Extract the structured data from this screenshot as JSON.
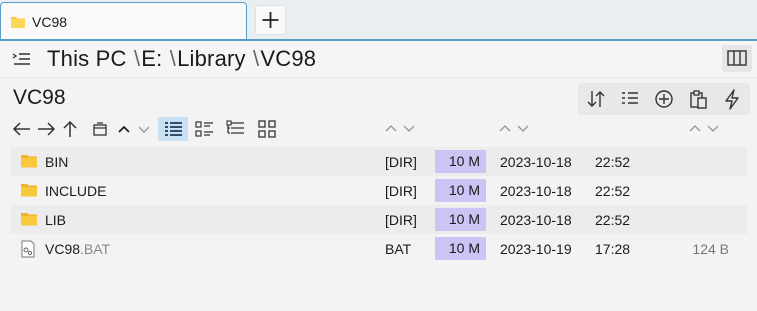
{
  "tab": {
    "title": "VC98"
  },
  "path": {
    "segments": [
      "This PC",
      "E:",
      "Library",
      "VC98"
    ]
  },
  "folder_title": "VC98",
  "toolbar": {
    "buttons": [
      "sort-icon",
      "list-view-icon",
      "add-icon",
      "paste-icon",
      "flash-icon"
    ]
  },
  "nav": {
    "buttons": [
      "back-arrow-icon",
      "forward-arrow-icon",
      "up-arrow-icon",
      "window-icon",
      "chevron-up-icon",
      "chevron-down-icon",
      "details-view-icon",
      "list-icons-view-icon",
      "tree-view-icon",
      "thumbnails-view-icon"
    ]
  },
  "sort_arrows": "⌃⌄",
  "files": [
    {
      "name": "BIN",
      "ext": "",
      "type": "[DIR]",
      "size": "10 M",
      "date": "2023-10-18",
      "time": "22:52",
      "bytes": "",
      "icon": "folder-icon"
    },
    {
      "name": "INCLUDE",
      "ext": "",
      "type": "[DIR]",
      "size": "10 M",
      "date": "2023-10-18",
      "time": "22:52",
      "bytes": "",
      "icon": "folder-icon"
    },
    {
      "name": "LIB",
      "ext": "",
      "type": "[DIR]",
      "size": "10 M",
      "date": "2023-10-18",
      "time": "22:52",
      "bytes": "",
      "icon": "folder-icon"
    },
    {
      "name": "VC98",
      "ext": ".BAT",
      "type": "BAT",
      "size": "10 M",
      "date": "2023-10-19",
      "time": "17:28",
      "bytes": "124 B",
      "icon": "batch-file-icon"
    }
  ],
  "colors": {
    "accent": "#5a9ec7",
    "size_highlight": "#cbc4f4",
    "folder": "#f8c93c",
    "selected_view": "#c9dff2"
  }
}
